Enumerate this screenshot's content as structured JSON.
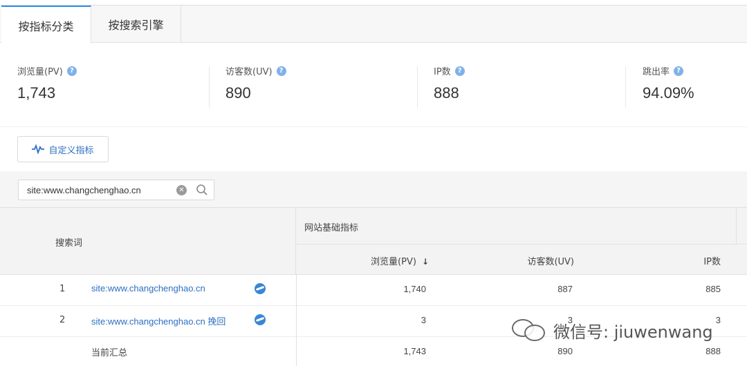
{
  "tabs": [
    {
      "label": "按指标分类",
      "active": true
    },
    {
      "label": "按搜索引擎",
      "active": false
    }
  ],
  "metrics": [
    {
      "label": "浏览量(PV)",
      "value": "1,743"
    },
    {
      "label": "访客数(UV)",
      "value": "890"
    },
    {
      "label": "IP数",
      "value": "888"
    },
    {
      "label": "跳出率",
      "value": "94.09%"
    }
  ],
  "help_icon": "?",
  "toolbar": {
    "custom_metrics_label": "自定义指标",
    "custom_metrics_icon": "pulse-icon"
  },
  "search": {
    "value": "site:www.changchenghao.cn"
  },
  "table": {
    "keyword_header": "搜索词",
    "group_header": "网站基础指标",
    "columns": [
      "浏览量(PV)",
      "访客数(UV)",
      "IP数"
    ],
    "sort_indicator": "↓",
    "rows": [
      {
        "index": "1",
        "keyword": "site:www.changchenghao.cn",
        "pv": "1,740",
        "uv": "887",
        "ip": "885"
      },
      {
        "index": "2",
        "keyword": "site:www.changchenghao.cn 挽回",
        "pv": "3",
        "uv": "3",
        "ip": "3"
      }
    ],
    "total": {
      "label": "当前汇总",
      "pv": "1,743",
      "uv": "890",
      "ip": "888"
    }
  },
  "watermark": {
    "text": "微信号: jiuwenwang"
  },
  "colors": {
    "accent": "#2d8cf0",
    "link": "#2d6fc2",
    "header_bg": "#f3f3f3"
  }
}
